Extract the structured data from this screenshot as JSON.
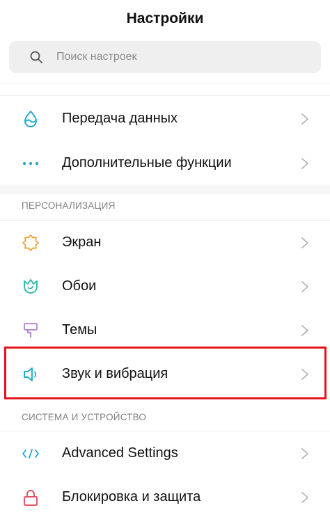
{
  "header": {
    "title": "Настройки"
  },
  "search": {
    "placeholder": "Поиск настроек",
    "icon": "search-icon"
  },
  "sections": {
    "personalization": "ПЕРСОНАЛИЗАЦИЯ",
    "system": "СИСТЕМА И УСТРОЙСТВО"
  },
  "items": [
    {
      "label": "Передача данных",
      "icon": "water-drop-icon",
      "color": "#1fa9c8"
    },
    {
      "label": "Дополнительные функции",
      "icon": "more-dots-icon",
      "color": "#1fa9c8"
    },
    {
      "label": "Экран",
      "icon": "sun-brightness-icon",
      "color": "#f0a23a"
    },
    {
      "label": "Обои",
      "icon": "tulip-flower-icon",
      "color": "#2cb9a8"
    },
    {
      "label": "Темы",
      "icon": "paint-roller-icon",
      "color": "#b48ad6"
    },
    {
      "label": "Звук и вибрация",
      "icon": "speaker-icon",
      "color": "#1fa9c8"
    },
    {
      "label": "Advanced Settings",
      "icon": "code-brackets-icon",
      "color": "#1fa9c8"
    },
    {
      "label": "Блокировка и защита",
      "icon": "lock-icon",
      "color": "#e2536a"
    }
  ],
  "highlight": {
    "color": "#e3141b",
    "target": "Звук и вибрация"
  }
}
